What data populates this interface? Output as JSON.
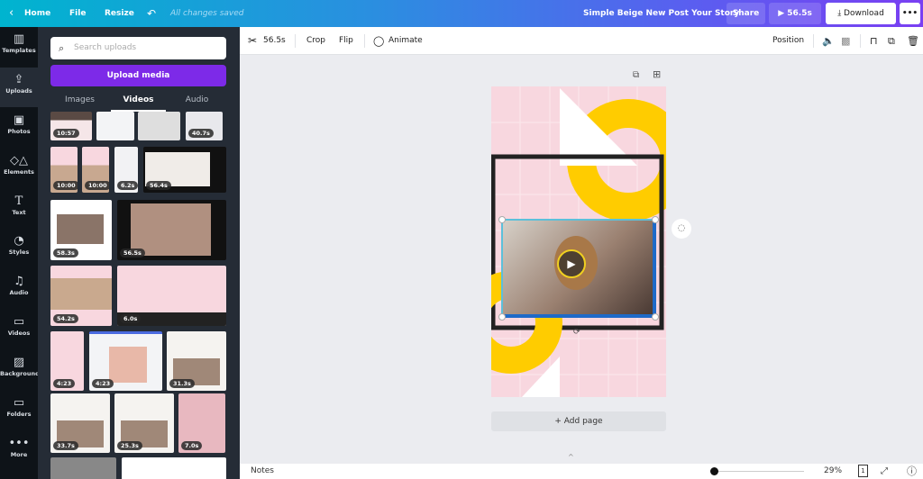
{
  "topbar": {
    "home": "Home",
    "file": "File",
    "resize": "Resize",
    "save_status": "All changes saved",
    "doc_title": "Simple Beige New Post Your Story",
    "share": "Share",
    "play_duration": "56.5s",
    "download": "Download",
    "more": "•••"
  },
  "rail": {
    "items": [
      {
        "label": "Templates",
        "icon": "▥"
      },
      {
        "label": "Uploads",
        "icon": "⇪"
      },
      {
        "label": "Photos",
        "icon": "▣"
      },
      {
        "label": "Elements",
        "icon": "◇△"
      },
      {
        "label": "Text",
        "icon": "T"
      },
      {
        "label": "Styles",
        "icon": "◔"
      },
      {
        "label": "Audio",
        "icon": "♫"
      },
      {
        "label": "Videos",
        "icon": "▭"
      },
      {
        "label": "Background",
        "icon": "▨"
      },
      {
        "label": "Folders",
        "icon": "▭"
      },
      {
        "label": "More",
        "icon": "•••"
      }
    ]
  },
  "panel": {
    "search_placeholder": "Search uploads",
    "upload_button": "Upload media",
    "tabs": [
      "Images",
      "Videos",
      "Audio"
    ],
    "active_tab": "Videos",
    "thumbs": [
      {
        "dur": "10:57"
      },
      {
        "dur": ""
      },
      {
        "dur": ""
      },
      {
        "dur": "40.7s"
      },
      {
        "dur": "10:00"
      },
      {
        "dur": "10:00"
      },
      {
        "dur": "6.2s"
      },
      {
        "dur": "56.4s"
      },
      {
        "dur": "58.3s"
      },
      {
        "dur": "56.5s"
      },
      {
        "dur": "54.2s"
      },
      {
        "dur": "6.0s"
      },
      {
        "dur": "4:23"
      },
      {
        "dur": "4:23"
      },
      {
        "dur": "31.3s"
      },
      {
        "dur": "33.7s"
      },
      {
        "dur": "25.3s"
      },
      {
        "dur": "7.0s"
      },
      {
        "dur": ""
      },
      {
        "dur": ""
      }
    ]
  },
  "toolbar": {
    "trim_duration": "56.5s",
    "crop": "Crop",
    "flip": "Flip",
    "animate": "Animate",
    "position": "Position"
  },
  "canvas": {
    "add_page": "+ Add page"
  },
  "bottom": {
    "notes": "Notes",
    "zoom": "29%",
    "zoom_fraction": 0.29,
    "page_count": "1"
  }
}
